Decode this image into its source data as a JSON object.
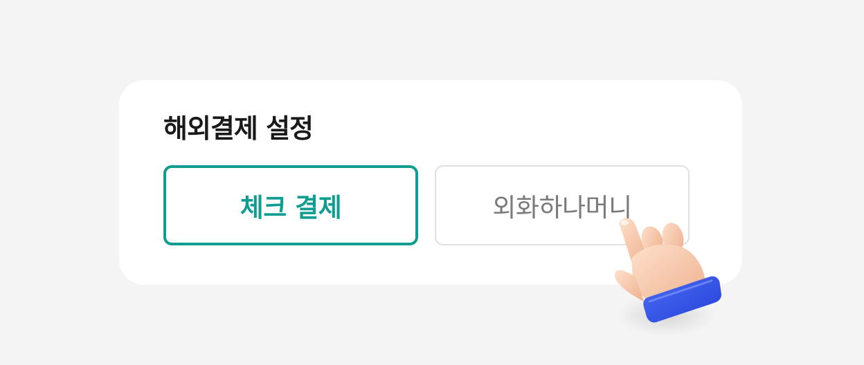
{
  "settings": {
    "title": "해외결제 설정",
    "options": [
      {
        "label": "체크 결제",
        "selected": true
      },
      {
        "label": "외화하나머니",
        "selected": false
      }
    ]
  },
  "colors": {
    "accent": "#0f9d92",
    "background": "#f4f4f4",
    "card": "#ffffff",
    "unselected_border": "#e0e0e0",
    "unselected_text": "#7a7a7a"
  },
  "icons": {
    "pointer": "pointing-hand-icon"
  }
}
